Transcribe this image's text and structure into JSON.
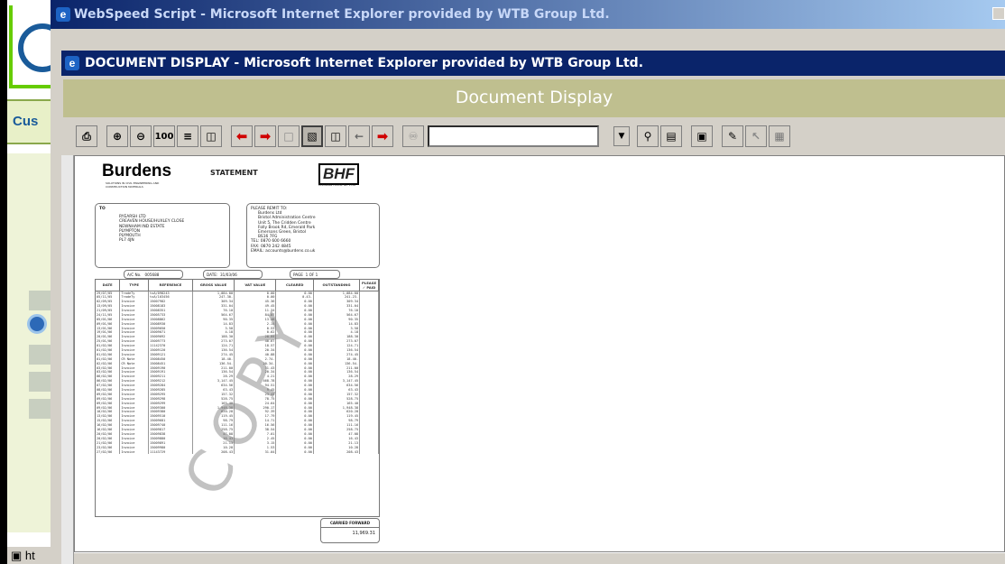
{
  "background": {
    "partial_text": "Cus",
    "taskbar_text": "ht"
  },
  "outer_window": {
    "title": "WebSpeed Script - Microsoft Internet Explorer provided by WTB Group Ltd."
  },
  "inner_window": {
    "title": "DOCUMENT DISPLAY - Microsoft Internet Explorer provided by WTB Group Ltd."
  },
  "doc_header": "Document Display",
  "toolbar": {
    "zoom_100_label": "100",
    "url_value": ""
  },
  "statement": {
    "logo": "Burdens",
    "logo_sub": "SOLUTIONS IN CIVIL ENGINEERING AND CONSTRUCTION MATERIALS",
    "heading": "STATEMENT",
    "bhf_logo": "BHF",
    "bhf_sub": "CLEARING HOUSE No. 1700",
    "to_label": "TO",
    "to_lines": [
      "RYEARSH LTD",
      "CREAVEN HOUSE/HUXLEY CLOSE",
      "NEWNHAM IND ESTATE",
      "PLYMPTON",
      "PLYMOUTH",
      "PL7 4JN"
    ],
    "remit_lines": [
      "PLEASE REMIT TO:",
      "Burdens Ltd",
      "Bristol Administration Centre",
      "Unit 5, The Cridden Centre",
      "Folly Brook Rd, Emerald Park",
      "Emersons Green, Bristol",
      "BS16 7FG",
      "TEL: 0870 600 6660",
      "FAX: 0870 242 4845",
      "EMAIL: accounts@burdens.co.uk"
    ],
    "ac_label": "A/C No.",
    "ac_value": "005688",
    "date_label": "DATE:",
    "date_value": "31/03/06",
    "page_label": "PAGE",
    "page_value": "1  OF  1",
    "columns": [
      "DATE",
      "TYPE",
      "REFERENCE",
      "GROSS VALUE",
      "VAT VALUE",
      "CLEARED",
      "OUTSTANDING",
      "PLEASE ✓ PAID"
    ],
    "rows": [
      [
        "29/07/05",
        "TradeTy",
        "txA/098243",
        "1,084.00",
        "0.00",
        "0.00",
        "1,084.00"
      ],
      [
        "05/11/05",
        "TradeTy",
        "txA/103456",
        "247.30-",
        "0.00",
        "0.43-",
        "241.23-"
      ],
      [
        "02/09/05",
        "Invoice",
        "15007982",
        "309.34",
        "45.36",
        "0.00",
        "309.34"
      ],
      [
        "13/09/05",
        "Invoice",
        "15008183",
        "331.04",
        "49.45",
        "0.00",
        "331.04"
      ],
      [
        "21/09/05",
        "Invoice",
        "15008351",
        "76.10",
        "11.34",
        "0.00",
        "76.10"
      ],
      [
        "24/11/05",
        "Invoice",
        "15005733",
        "564.67",
        "84.07",
        "0.00",
        "564.67"
      ],
      [
        "05/01/06",
        "Invoice",
        "15008862",
        "90.35",
        "13.48",
        "0.00",
        "90.35"
      ],
      [
        "09/01/06",
        "Invoice",
        "15008930",
        "14.83",
        "2.14",
        "0.00",
        "14.83"
      ],
      [
        "13/01/06",
        "Invoice",
        "15009050",
        "3.58",
        "0.53",
        "0.00",
        "3.58"
      ],
      [
        "19/01/06",
        "Invoice",
        "15009071",
        "4.18",
        "0.62",
        "0.00",
        "4.18"
      ],
      [
        "20/01/06",
        "Invoice",
        "15009092",
        "188.30",
        "28.04",
        "0.00",
        "188.30"
      ],
      [
        "25/01/06",
        "Invoice",
        "15009773",
        "273.07",
        "40.67",
        "0.00",
        "273.07"
      ],
      [
        "01/02/06",
        "Invoice",
        "11142370",
        "124.71",
        "18.57",
        "0.00",
        "124.71"
      ],
      [
        "01/02/06",
        "Invoice",
        "15009120",
        "136.54",
        "20.34",
        "0.00",
        "136.54"
      ],
      [
        "01/02/06",
        "Invoice",
        "15009121",
        "274.45",
        "40.88",
        "0.00",
        "274.45"
      ],
      [
        "01/02/06",
        "CR Note",
        "15008450",
        "18.40-",
        "2.74-",
        "0.00",
        "18.40-"
      ],
      [
        "02/02/06",
        "CR Note",
        "15008451",
        "136.54-",
        "20.34-",
        "0.00",
        "136.54-"
      ],
      [
        "03/02/06",
        "Invoice",
        "15009190",
        "211.00",
        "31.43",
        "0.00",
        "211.00"
      ],
      [
        "03/02/06",
        "Invoice",
        "15009191",
        "136.54",
        "20.34",
        "0.00",
        "136.54"
      ],
      [
        "06/02/06",
        "Invoice",
        "15009211",
        "28.29",
        "4.21",
        "0.00",
        "28.29"
      ],
      [
        "06/02/06",
        "Invoice",
        "15009212",
        "3,147.45",
        "468.78",
        "0.00",
        "3,147.45"
      ],
      [
        "07/02/06",
        "Invoice",
        "15009284",
        "634.56",
        "94.51",
        "0.00",
        "634.56"
      ],
      [
        "08/02/06",
        "Invoice",
        "15009285",
        "63.43",
        "9.45",
        "0.00",
        "63.43"
      ],
      [
        "09/02/06",
        "Invoice",
        "15009295",
        "157.32",
        "23.43",
        "0.00",
        "157.32"
      ],
      [
        "09/02/06",
        "Invoice",
        "15009298",
        "528.75",
        "78.75",
        "0.00",
        "528.75"
      ],
      [
        "09/02/06",
        "Invoice",
        "15009299",
        "165.40",
        "24.64",
        "0.00",
        "165.40"
      ],
      [
        "09/02/06",
        "Invoice",
        "15009300",
        "1,948.38",
        "290.17",
        "0.00",
        "1,948.38"
      ],
      [
        "10/02/06",
        "Invoice",
        "15009380",
        "620.28",
        "92.39",
        "0.00",
        "620.28"
      ],
      [
        "13/02/06",
        "Invoice",
        "15009510",
        "119.45",
        "17.79",
        "0.00",
        "119.45"
      ],
      [
        "15/02/06",
        "Invoice",
        "15009681",
        "98.79",
        "14.71",
        "0.00",
        "98.79"
      ],
      [
        "16/02/06",
        "Invoice",
        "15009740",
        "111.16",
        "16.56",
        "0.00",
        "111.16"
      ],
      [
        "16/02/06",
        "Invoice",
        "15009817",
        "258.75",
        "38.54",
        "0.00",
        "258.75"
      ],
      [
        "20/02/06",
        "Invoice",
        "15009838",
        "47.08",
        "7.01",
        "0.00",
        "47.08"
      ],
      [
        "20/02/06",
        "Invoice",
        "15009880",
        "16.43",
        "2.45",
        "0.00",
        "16.43"
      ],
      [
        "21/02/06",
        "Invoice",
        "15009891",
        "21.13",
        "3.15",
        "0.00",
        "21.13"
      ],
      [
        "23/02/06",
        "Invoice",
        "15009980",
        "10.28",
        "1.53",
        "0.00",
        "10.28"
      ],
      [
        "27/02/06",
        "Invoice",
        "11143729",
        "208.43",
        "31.04",
        "0.00",
        "208.43"
      ]
    ],
    "watermark": "COPY",
    "carried_forward_label": "CARRIED FORWARD",
    "carried_forward_value": "11,969.31"
  }
}
